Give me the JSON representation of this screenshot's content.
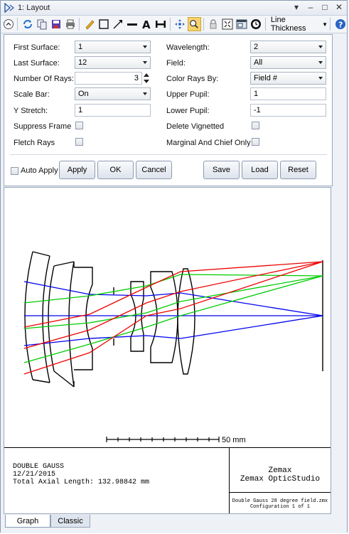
{
  "window": {
    "title": "1: Layout"
  },
  "toolbar": {
    "icons": [
      "expand-icon",
      "refresh-icon",
      "copy-icon",
      "save-icon",
      "print-icon",
      "pencil-icon",
      "rectangle-icon",
      "arrow-icon",
      "line-icon",
      "text-icon",
      "dimension-icon",
      "pan-icon",
      "zoom-icon",
      "lock-icon",
      "fit-icon",
      "window-icon",
      "clock-icon",
      "help-icon"
    ],
    "line_thickness_label": "Line Thickness",
    "selected_color": "#f8d26b"
  },
  "settings": {
    "first_surface_label": "First Surface:",
    "first_surface_value": "1",
    "last_surface_label": "Last Surface:",
    "last_surface_value": "12",
    "number_of_rays_label": "Number Of Rays:",
    "number_of_rays_value": "3",
    "scale_bar_label": "Scale Bar:",
    "scale_bar_value": "On",
    "y_stretch_label": "Y Stretch:",
    "y_stretch_value": "1",
    "suppress_frame_label": "Suppress Frame",
    "fletch_rays_label": "Fletch Rays",
    "wavelength_label": "Wavelength:",
    "wavelength_value": "2",
    "field_label": "Field:",
    "field_value": "All",
    "color_rays_by_label": "Color Rays By:",
    "color_rays_by_value": "Field #",
    "upper_pupil_label": "Upper Pupil:",
    "upper_pupil_value": "1",
    "lower_pupil_label": "Lower Pupil:",
    "lower_pupil_value": "-1",
    "delete_vignetted_label": "Delete Vignetted",
    "marginal_chief_label": "Marginal And Chief Only"
  },
  "buttons": {
    "auto_apply": "Auto Apply",
    "apply": "Apply",
    "ok": "OK",
    "cancel": "Cancel",
    "save": "Save",
    "load": "Load",
    "reset": "Reset"
  },
  "graph": {
    "scale_label": "50 mm",
    "ray_colors": {
      "field1": "#0000ee",
      "field2": "#00cc00",
      "field3": "#ee0000"
    },
    "footer": {
      "lens_name": "DOUBLE GAUSS",
      "date": "12/21/2015",
      "axial_length": "Total Axial Length:  132.98842 mm",
      "company": "Zemax",
      "product": "Zemax OpticStudio",
      "file": "Double Gauss 28 degree field.zmx",
      "configuration": "Configuration 1 of 1"
    }
  },
  "tabs": {
    "graph": "Graph",
    "classic": "Classic"
  }
}
